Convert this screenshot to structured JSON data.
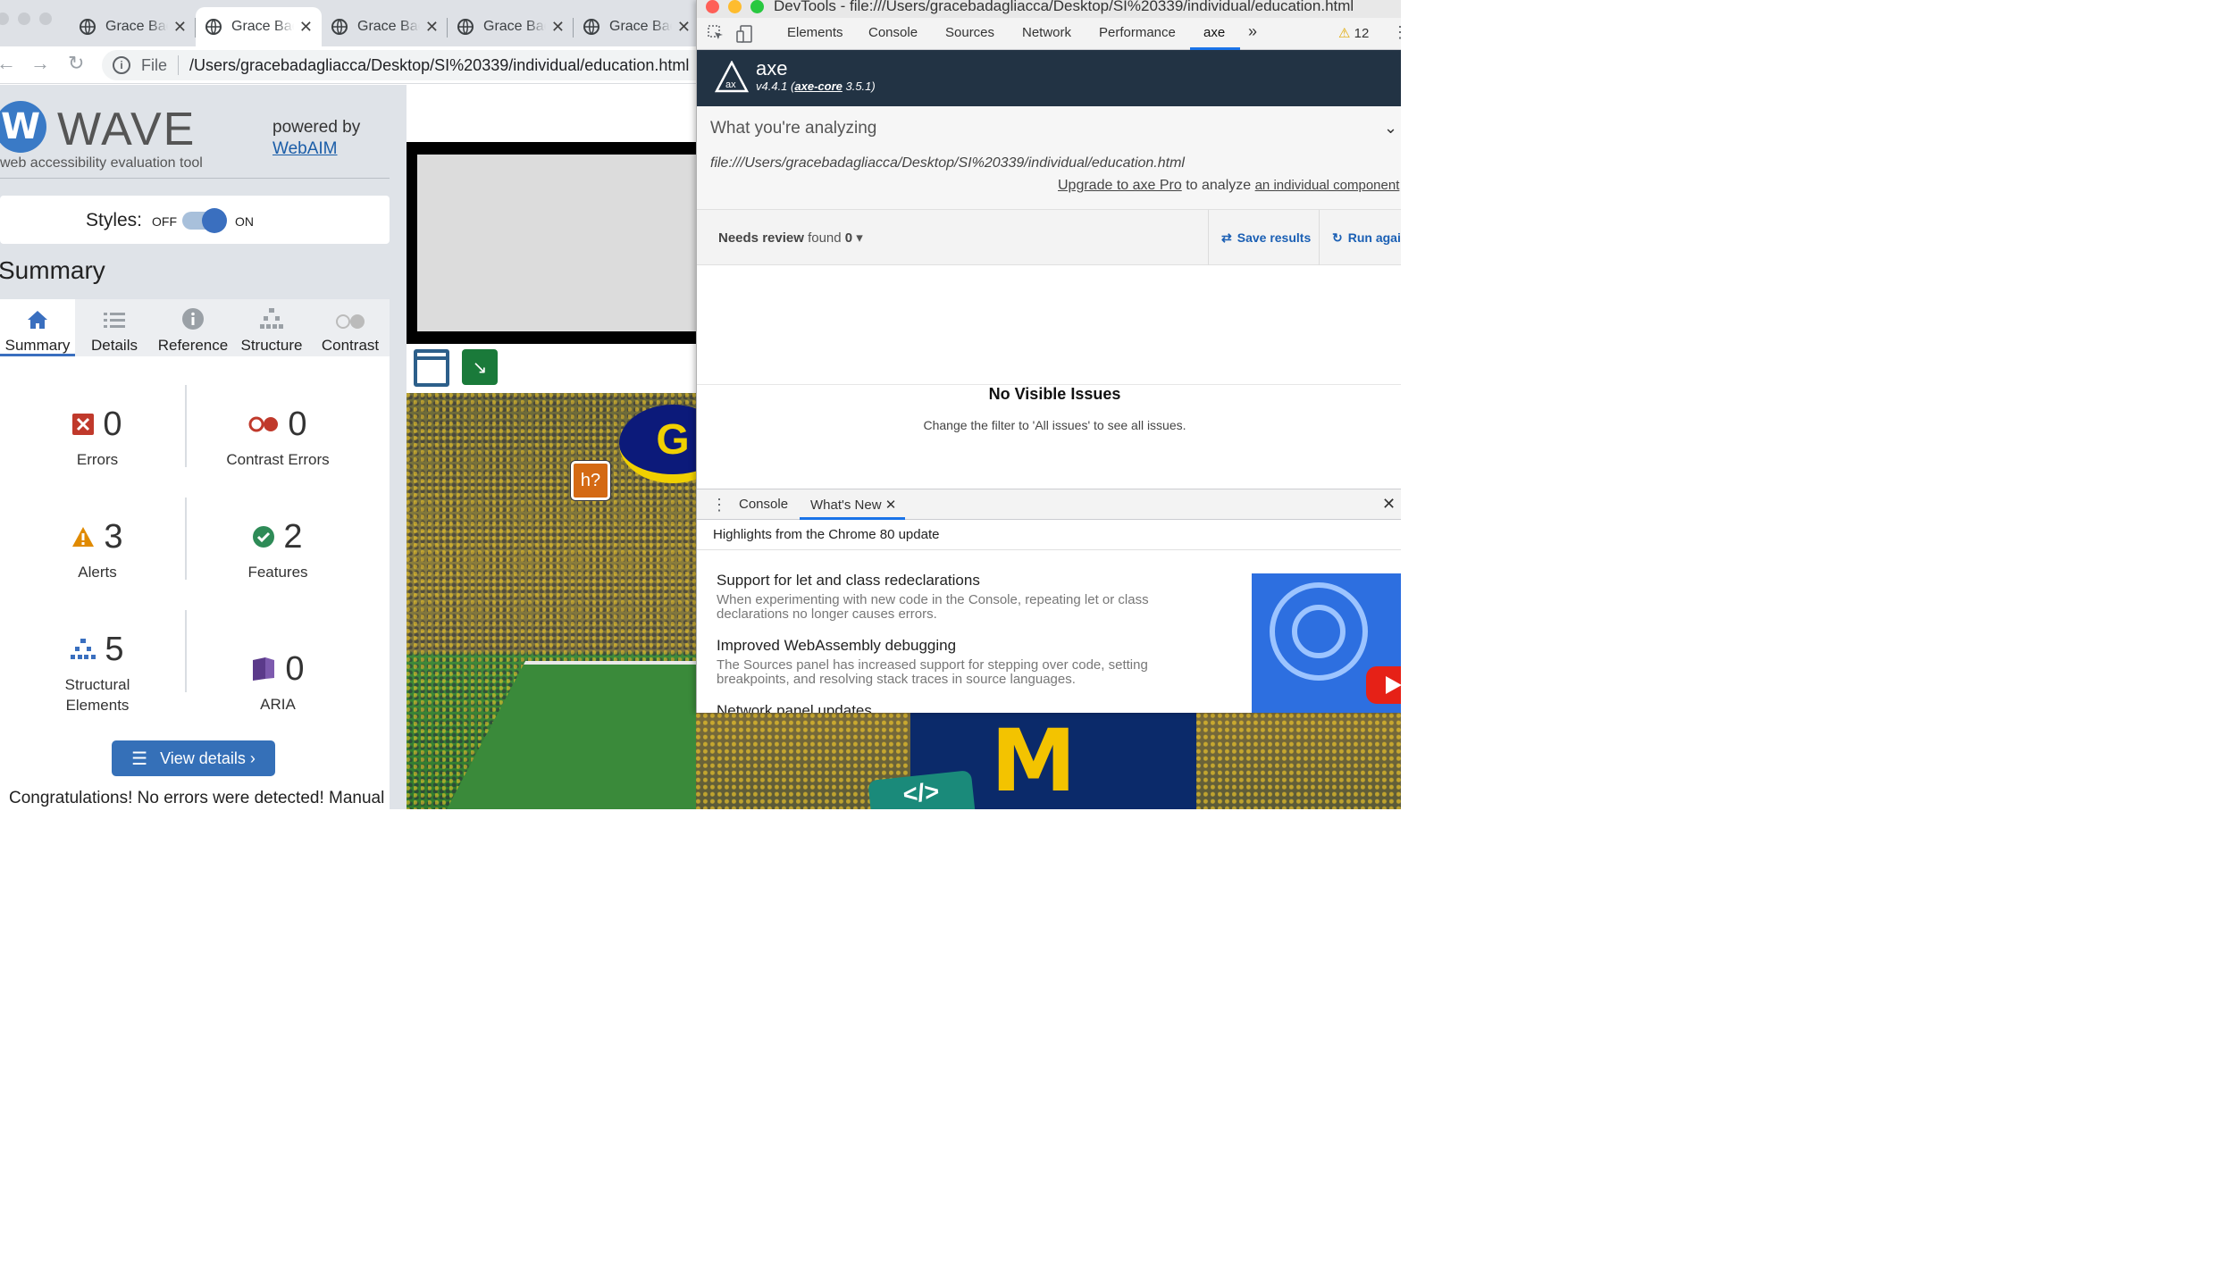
{
  "browser": {
    "tabs": [
      {
        "label": "Grace Badagliacca"
      },
      {
        "label": "Grace Badagliacca"
      },
      {
        "label": "Grace Badagliacca"
      },
      {
        "label": "Grace Badagliacca"
      },
      {
        "label": "Grace Badagliacca"
      }
    ],
    "active_tab": 1,
    "scheme_label": "File",
    "url": "/Users/gracebadagliacca/Desktop/SI%20339/individual/education.html"
  },
  "wave": {
    "logo_letter": "W",
    "wordmark": "WAVE",
    "tagline": "web accessibility evaluation tool",
    "powered_by": "powered by",
    "webaim_link": "WebAIM",
    "styles_label": "Styles:",
    "styles_off": "OFF",
    "styles_on": "ON",
    "styles_enabled": true,
    "summary_heading": "Summary",
    "tabs": [
      {
        "label": "Summary",
        "icon": "home-icon"
      },
      {
        "label": "Details",
        "icon": "list-icon"
      },
      {
        "label": "Reference",
        "icon": "info-icon"
      },
      {
        "label": "Structure",
        "icon": "hierarchy-icon"
      },
      {
        "label": "Contrast",
        "icon": "contrast-icon"
      }
    ],
    "stats": {
      "errors": {
        "value": "0",
        "label": "Errors"
      },
      "contrast_errors": {
        "value": "0",
        "label": "Contrast Errors"
      },
      "alerts": {
        "value": "3",
        "label": "Alerts"
      },
      "features": {
        "value": "2",
        "label": "Features"
      },
      "structural": {
        "value": "5",
        "label": "Structural Elements"
      },
      "aria": {
        "value": "0",
        "label": "ARIA"
      }
    },
    "view_details": "View details ›",
    "congrats": "Congratulations! No errors were detected! Manual",
    "colors": {
      "accent": "#3570b8",
      "error": "#c0392b",
      "alert": "#e08a00",
      "feature": "#2e8b57",
      "aria": "#5b3a8a"
    }
  },
  "page": {
    "h_marker": "h?",
    "code_badge": "</>"
  },
  "devtools": {
    "title": "DevTools - file:///Users/gracebadagliacca/Desktop/SI%20339/individual/education.html",
    "tabs": [
      "Elements",
      "Console",
      "Sources",
      "Network",
      "Performance",
      "axe"
    ],
    "active_tab": "axe",
    "more": "»",
    "warning_count": "12",
    "axe": {
      "name": "axe",
      "version": "v4.4.1",
      "core_link": "axe-core",
      "core_version": "3.5.1",
      "analyzing_heading": "What you're analyzing",
      "analyzing_url": "file:///Users/gracebadagliacca/Desktop/SI%20339/individual/education.html",
      "upgrade_link": "Upgrade to axe Pro",
      "upgrade_text": "to analyze",
      "component_link": "an individual component",
      "filter_label": "Needs review",
      "found_text": "found",
      "found_count": "0",
      "save_results": "Save results",
      "run_again": "Run again",
      "no_issues_heading": "No Visible Issues",
      "no_issues_text": "Change the filter to 'All issues' to see all issues."
    },
    "drawer": {
      "tabs": [
        "Console",
        "What's New"
      ],
      "active_tab": "What's New",
      "highlights": "Highlights from the Chrome 80 update",
      "items": [
        {
          "title": "Support for let and class redeclarations",
          "body": "When experimenting with new code in the Console, repeating let or class declarations no longer causes errors."
        },
        {
          "title": "Improved WebAssembly debugging",
          "body": "The Sources panel has increased support for stepping over code, setting breakpoints, and resolving stack traces in source languages."
        },
        {
          "title": "Network panel updates",
          "body": ""
        }
      ]
    }
  }
}
